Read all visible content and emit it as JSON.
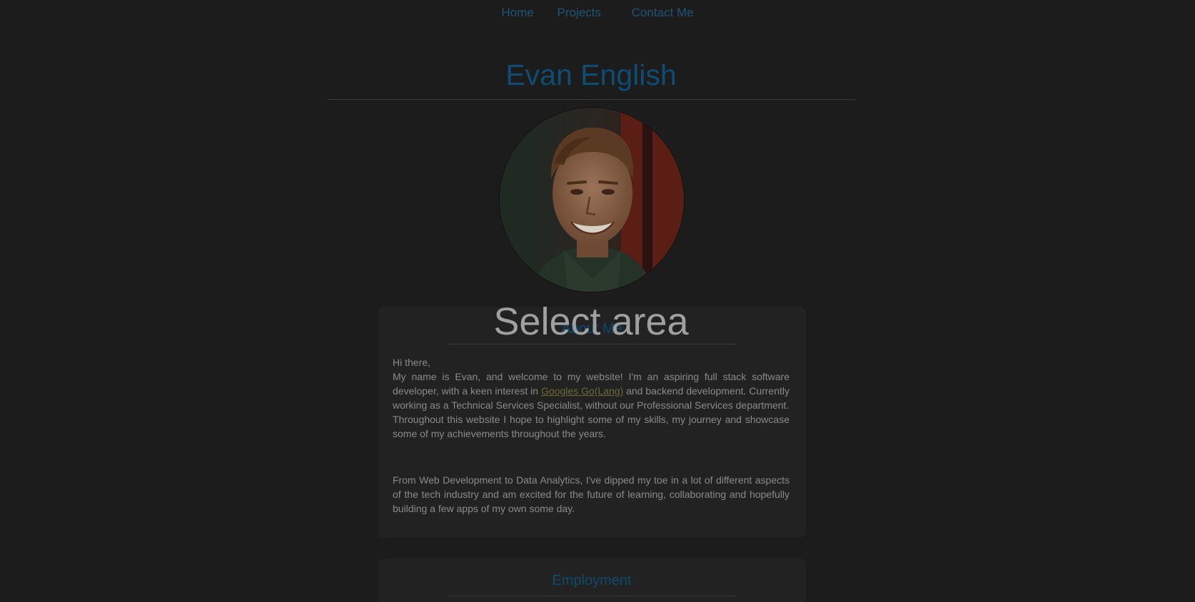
{
  "nav": {
    "items": [
      "Home",
      "Projects",
      "Contact Me"
    ]
  },
  "header": {
    "name": "Evan English"
  },
  "about": {
    "title": "About Me",
    "greeting": "Hi there,",
    "p1_before_link": "My name is Evan, and welcome to my website! I'm an aspiring full stack software developer, with a keen interest in ",
    "link_text": "Googles Go(Lang)",
    "p1_after_link": " and backend development. Currently working as a Technical Services Specialist, without our Professional Services department.",
    "p2": "Throughout this website I hope to highlight some of my skills, my journey and showcase some of my achievements throughout the years.",
    "p3": "From Web Development to Data Analytics, I've dipped my toe in a lot of different aspects of the tech industry and am excited for the future of learning, collaborating and hopefully building a few apps of my own some day."
  },
  "employment": {
    "title": "Employment"
  },
  "overlay": {
    "label": "Select area"
  },
  "colors": {
    "background": "#1c1c1c",
    "card": "#222222",
    "heading_blue": "#0e4c73",
    "nav_blue": "#1d5577",
    "link": "#6b6b34"
  },
  "icons": {
    "avatar": "profile-photo"
  }
}
